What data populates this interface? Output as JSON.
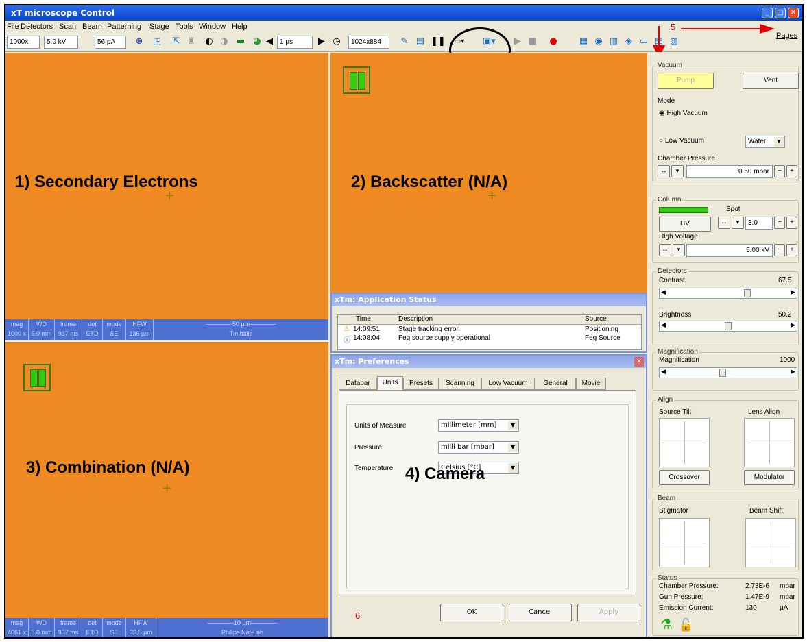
{
  "window": {
    "title": "xT microscope Control"
  },
  "menu": [
    "File",
    "Detectors",
    "Scan",
    "Beam",
    "Patterning",
    "Stage",
    "Tools",
    "Window",
    "Help"
  ],
  "toolbar": {
    "mag": "1000x",
    "kv": "5.0 kV",
    "current": "56 pA",
    "dwell": "1 µs",
    "resolution": "1024x884"
  },
  "annotations": {
    "pages_number": "5",
    "pages_label": "Pages",
    "prefs_number": "6"
  },
  "quadrants": {
    "q1": "1) Secondary Electrons",
    "q2": "2) Backscatter (N/A)",
    "q3": "3) Combination (N/A)",
    "q4": "4) Camera"
  },
  "databar_top": {
    "labels": [
      "mag",
      "WD",
      "frame",
      "det",
      "mode",
      "HFW"
    ],
    "values": [
      "1000 x",
      "5.0 mm",
      "937 ms",
      "ETD",
      "SE",
      "136 µm"
    ],
    "scale": "50 µm",
    "sample": "Tin balls"
  },
  "databar_bottom": {
    "labels": [
      "mag",
      "WD",
      "frame",
      "det",
      "mode",
      "HFW"
    ],
    "values": [
      "4061 x",
      "5.0 mm",
      "937 ms",
      "ETD",
      "SE",
      "33.5 µm"
    ],
    "scale": "10 µm",
    "sample": "Philips Nat-Lab"
  },
  "app_status": {
    "title": "xTm: Application Status",
    "headers": [
      "Time",
      "Description",
      "Source"
    ],
    "rows": [
      {
        "time": "14:09:51",
        "desc": "Stage tracking error.",
        "source": "Positioning"
      },
      {
        "time": "14:08:04",
        "desc": "Feg source supply operational",
        "source": "Feg Source"
      }
    ]
  },
  "prefs": {
    "title": "xTm: Preferences",
    "tabs": [
      "Databar",
      "Units",
      "Presets",
      "Scanning",
      "Low Vacuum",
      "General",
      "Movie"
    ],
    "fields": [
      {
        "label": "Units of Measure",
        "value": "millimeter [mm]"
      },
      {
        "label": "Pressure",
        "value": "milli bar [mbar]"
      },
      {
        "label": "Temperature",
        "value": "Celsius [°C]"
      }
    ],
    "ok": "OK",
    "cancel": "Cancel",
    "apply": "Apply"
  },
  "panel": {
    "vacuum": {
      "title": "Vacuum",
      "pump": "Pump",
      "vent": "Vent",
      "mode": "Mode",
      "high": "High Vacuum",
      "low": "Low Vacuum",
      "gas": "Water",
      "chamber_label": "Chamber Pressure",
      "chamber_value": "0.50 mbar"
    },
    "column": {
      "title": "Column",
      "spot_label": "Spot",
      "spot_value": "3.0",
      "hv_button": "HV",
      "hv_label": "High Voltage",
      "hv_value": "5.00 kV"
    },
    "detectors": {
      "title": "Detectors",
      "contrast_label": "Contrast",
      "contrast_value": "67.5",
      "contrast_level": 0.67,
      "brightness_label": "Brightness",
      "brightness_value": "50.2",
      "brightness_level": 0.5
    },
    "magnification": {
      "title": "Magnification",
      "label": "Magnification",
      "value": "1000",
      "level": 0.45
    },
    "align": {
      "title": "Align",
      "source_tilt": "Source Tilt",
      "lens_align": "Lens Align",
      "crossover": "Crossover",
      "modulator": "Modulator"
    },
    "beam": {
      "title": "Beam",
      "stigmator": "Stigmator",
      "beam_shift": "Beam Shift"
    },
    "status": {
      "title": "Status",
      "rows": [
        {
          "label": "Chamber Pressure:",
          "value": "2.73E-6",
          "unit": "mbar"
        },
        {
          "label": "Gun Pressure:",
          "value": "1.47E-9",
          "unit": "mbar"
        },
        {
          "label": "Emission Current:",
          "value": "130",
          "unit": "µA"
        }
      ]
    }
  },
  "colors": {
    "quadrant": "#ef8a22",
    "titlebar": "#0a47c8",
    "databar": "#4d6fd0",
    "annotation": "#e00000"
  }
}
